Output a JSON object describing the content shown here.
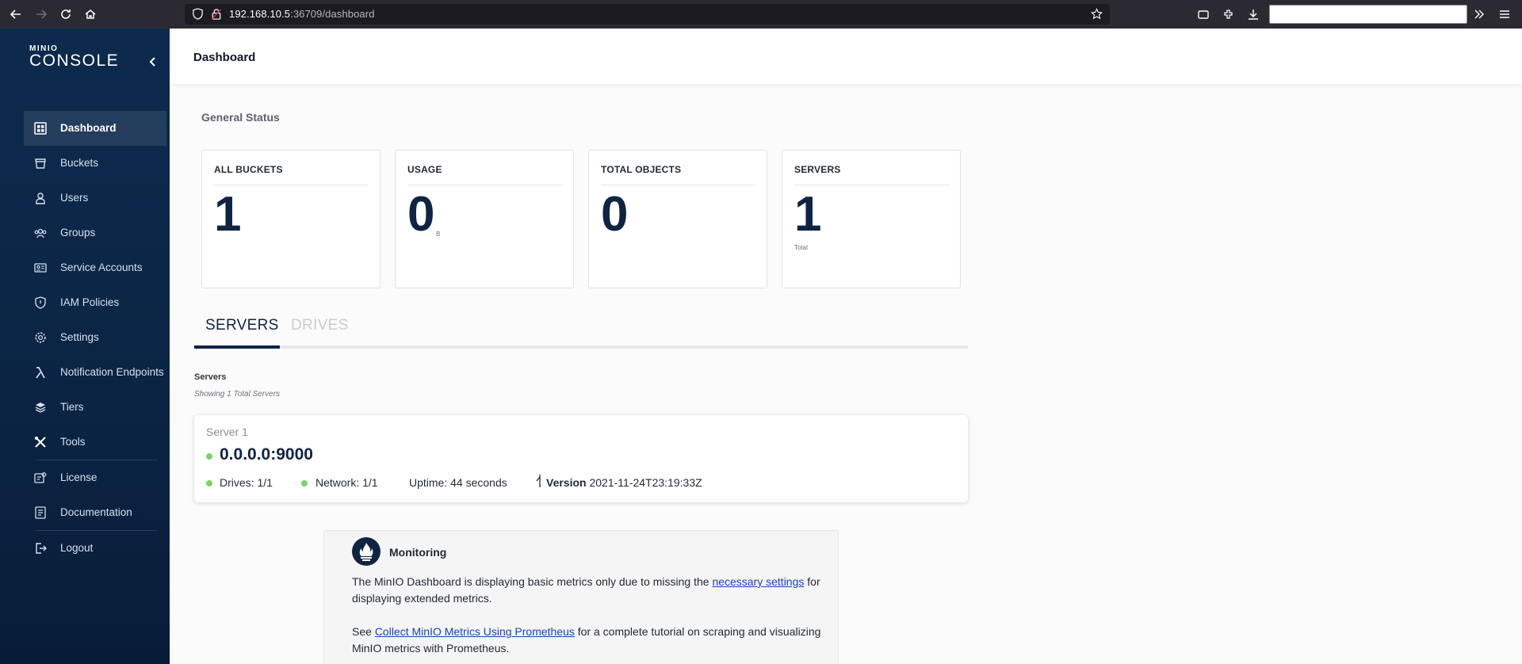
{
  "browser": {
    "url_host": "192.168.10.5",
    "url_rest": ":36709/dashboard"
  },
  "sidebar": {
    "logo_small": "MINIO",
    "logo_big": "CONSOLE",
    "items": [
      {
        "label": "Dashboard",
        "icon": "dashboard-icon",
        "active": true
      },
      {
        "label": "Buckets",
        "icon": "bucket-icon"
      },
      {
        "label": "Users",
        "icon": "user-icon"
      },
      {
        "label": "Groups",
        "icon": "groups-icon"
      },
      {
        "label": "Service Accounts",
        "icon": "service-accounts-icon"
      },
      {
        "label": "IAM Policies",
        "icon": "shield-icon"
      },
      {
        "label": "Settings",
        "icon": "gear-icon"
      },
      {
        "label": "Notification Endpoints",
        "icon": "lambda-icon"
      },
      {
        "label": "Tiers",
        "icon": "layers-icon"
      },
      {
        "label": "Tools",
        "icon": "tools-icon"
      },
      {
        "label": "License",
        "icon": "license-icon"
      },
      {
        "label": "Documentation",
        "icon": "documentation-icon"
      },
      {
        "label": "Logout",
        "icon": "logout-icon"
      }
    ]
  },
  "header": {
    "title": "Dashboard"
  },
  "general_status": {
    "title": "General Status",
    "cards": [
      {
        "title": "ALL BUCKETS",
        "value": "1",
        "unit": ""
      },
      {
        "title": "USAGE",
        "value": "0",
        "unit": "B"
      },
      {
        "title": "TOTAL OBJECTS",
        "value": "0",
        "unit": ""
      },
      {
        "title": "SERVERS",
        "value": "1",
        "unit": "Total"
      }
    ]
  },
  "tabs": {
    "servers": "SERVERS",
    "drives": "DRIVES"
  },
  "servers": {
    "label": "Servers",
    "subtitle": "Showing 1 Total Servers",
    "server": {
      "name": "Server 1",
      "endpoint": "0.0.0.0:9000",
      "drives": "Drives: 1/1",
      "network": "Network: 1/1",
      "uptime": "Uptime: 44 seconds",
      "version_label": "Version",
      "version_value": "2021-11-24T23:19:33Z"
    }
  },
  "monitoring": {
    "title": "Monitoring",
    "p1_before": "The MinIO Dashboard is displaying basic metrics only due to missing the ",
    "p1_link": "necessary settings",
    "p1_after": " for displaying extended metrics.",
    "p2_before": "See ",
    "p2_link": "Collect MinIO Metrics Using Prometheus",
    "p2_after": " for a complete tutorial on scraping and visualizing MinIO metrics with Prometheus."
  },
  "colors": {
    "sidebar_bg": "#0d2a4d",
    "accent": "#0f2344",
    "status_ok": "#7ad36a",
    "link": "#1a3fc4"
  }
}
